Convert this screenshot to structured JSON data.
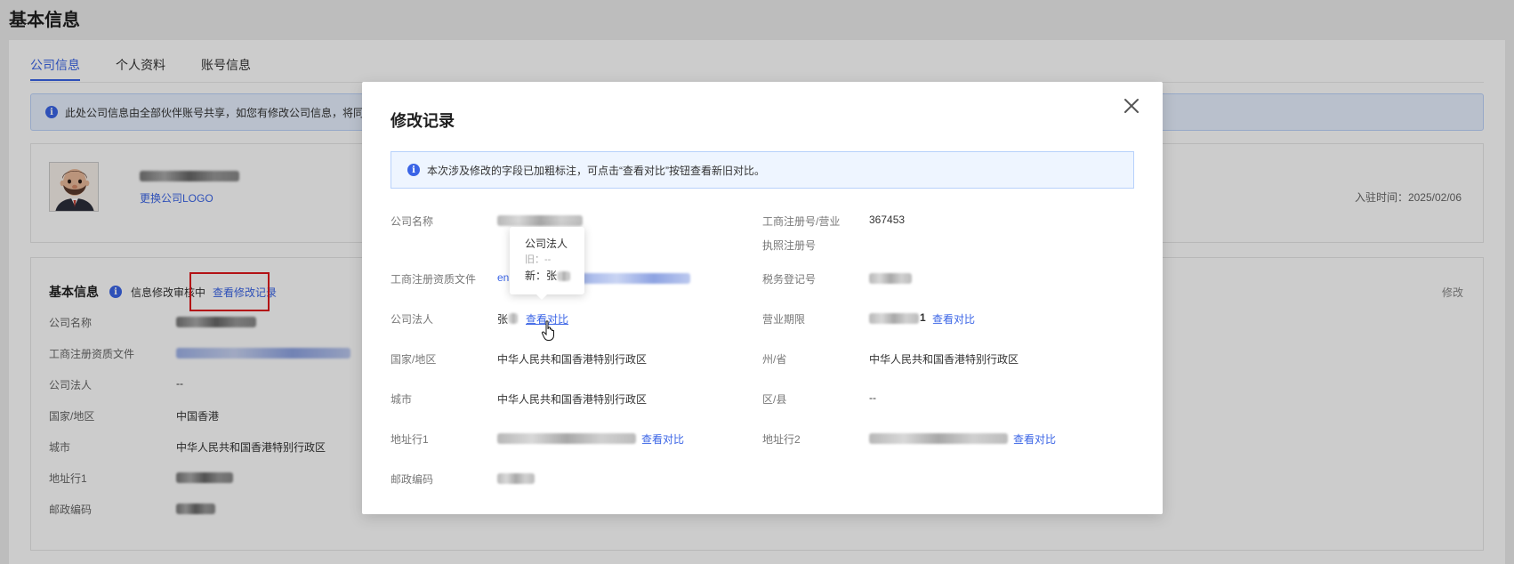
{
  "page_title": "基本信息",
  "tabs": [
    "公司信息",
    "个人资料",
    "账号信息"
  ],
  "active_tab": 0,
  "notice_text": "此处公司信息由全部伙伴账号共享，如您有修改公司信息，将同",
  "company_card": {
    "change_logo": "更换公司LOGO",
    "join_time": "入驻时间：2025/02/06"
  },
  "basic_info": {
    "heading": "基本信息",
    "review_status": "信息修改审核中",
    "view_history": "查看修改记录",
    "edit": "修改",
    "rows": [
      {
        "label": "公司名称",
        "value": ""
      },
      {
        "label": "工商注册资质文件",
        "value": ""
      },
      {
        "label": "公司法人",
        "value": "--"
      },
      {
        "label": "国家/地区",
        "value": "中国香港"
      },
      {
        "label": "城市",
        "value": "中华人民共和国香港特别行政区"
      },
      {
        "label": "地址行1",
        "value": ""
      },
      {
        "label": "邮政编码",
        "value": ""
      }
    ]
  },
  "modal": {
    "title": "修改记录",
    "notice": "本次涉及修改的字段已加粗标注，可点击“查看对比”按钮查看新旧对比。",
    "compare_link": "查看对比",
    "left_fields": {
      "company_name_label": "公司名称",
      "reg_file_label": "工商注册资质文件",
      "reg_file_value": "en",
      "legal_person_label": "公司法人",
      "legal_person_value": "张",
      "country_label": "国家/地区",
      "country_value": "中华人民共和国香港特别行政区",
      "city_label": "城市",
      "city_value": "中华人民共和国香港特别行政区",
      "address1_label": "地址行1",
      "postal_label": "邮政编码"
    },
    "right_fields": {
      "reg_no_label_line1": "工商注册号/营业",
      "reg_no_label_line2": "执照注册号",
      "reg_no_value": "367453",
      "tax_label": "税务登记号",
      "term_label": "营业期限",
      "term_value_suffix": "1",
      "state_label": "州/省",
      "state_value": "中华人民共和国香港特别行政区",
      "district_label": "区/县",
      "district_value": "--",
      "address2_label": "地址行2"
    },
    "tooltip": {
      "title": "公司法人",
      "old": "旧：--",
      "new": "新：张"
    }
  },
  "colors": {
    "primary": "#3a64e6",
    "highlight_box": "#e0161b",
    "notice_bg": "#eef5ff"
  }
}
